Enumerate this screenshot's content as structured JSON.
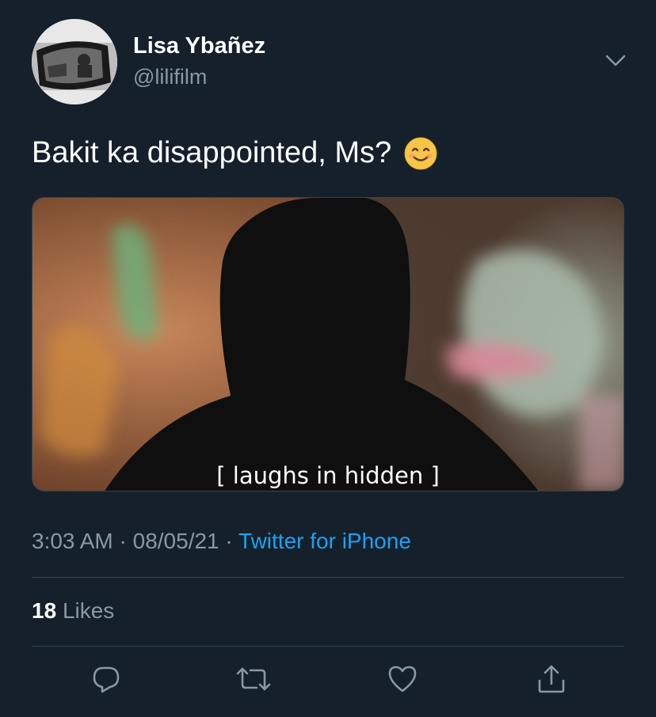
{
  "tweet": {
    "author": {
      "name": "Lisa Ybañez",
      "handle": "@lilifilm"
    },
    "text": "Bakit ka disappointed, Ms?",
    "emoji_icon": "smiling-face-icon",
    "media": {
      "caption": "[ laughs in hidden ]"
    },
    "time": "3:03 AM",
    "date": "08/05/21",
    "separator": "·",
    "source": "Twitter for iPhone",
    "likes": {
      "count": "18",
      "label": "Likes"
    },
    "actions": [
      "reply-icon",
      "retweet-icon",
      "like-icon",
      "share-icon"
    ]
  },
  "colors": {
    "background": "#15202b",
    "secondary_text": "#8899a6",
    "link": "#1da1f2",
    "divider": "#38444d"
  }
}
